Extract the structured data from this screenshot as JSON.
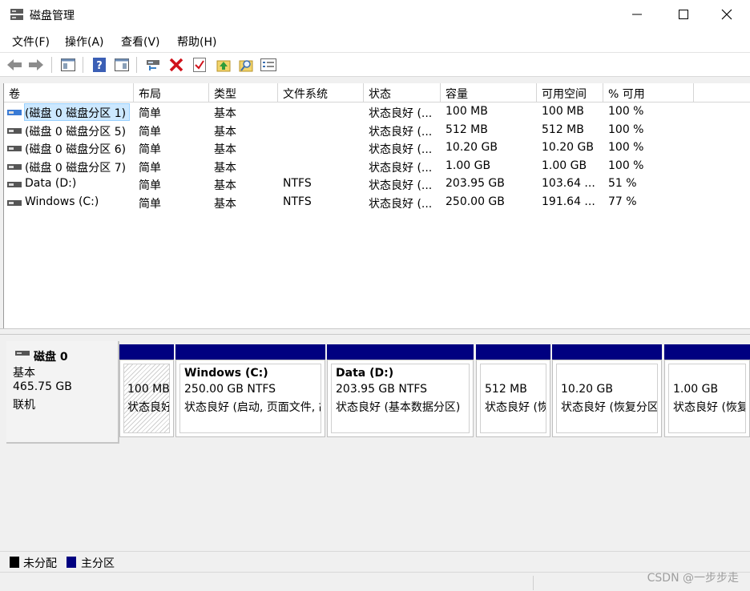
{
  "window": {
    "title": "磁盘管理",
    "icon": "disk-management-icon",
    "controls": [
      "minimize-icon",
      "maximize-icon",
      "close-icon"
    ]
  },
  "menu": [
    "文件(F)",
    "操作(A)",
    "查看(V)",
    "帮助(H)"
  ],
  "toolbar": [
    "back-icon",
    "forward-icon",
    "console-tree-icon",
    "help-icon",
    "show-pane-icon",
    "connect-disk-icon",
    "delete-icon",
    "properties-check-icon",
    "up-icon",
    "search-icon",
    "details-icon"
  ],
  "columns": [
    "卷",
    "布局",
    "类型",
    "文件系统",
    "状态",
    "容量",
    "可用空间",
    "% 可用"
  ],
  "volumes": [
    {
      "vol": "(磁盘 0 磁盘分区 1)",
      "layout": "简单",
      "type": "基本",
      "fs": "",
      "status": "状态良好 (...",
      "capacity": "100 MB",
      "free": "100 MB",
      "pct": "100 %",
      "selected": true
    },
    {
      "vol": "(磁盘 0 磁盘分区 5)",
      "layout": "简单",
      "type": "基本",
      "fs": "",
      "status": "状态良好 (...",
      "capacity": "512 MB",
      "free": "512 MB",
      "pct": "100 %"
    },
    {
      "vol": "(磁盘 0 磁盘分区 6)",
      "layout": "简单",
      "type": "基本",
      "fs": "",
      "status": "状态良好 (...",
      "capacity": "10.20 GB",
      "free": "10.20 GB",
      "pct": "100 %"
    },
    {
      "vol": "(磁盘 0 磁盘分区 7)",
      "layout": "简单",
      "type": "基本",
      "fs": "",
      "status": "状态良好 (...",
      "capacity": "1.00 GB",
      "free": "1.00 GB",
      "pct": "100 %"
    },
    {
      "vol": "Data (D:)",
      "layout": "简单",
      "type": "基本",
      "fs": "NTFS",
      "status": "状态良好 (...",
      "capacity": "203.95 GB",
      "free": "103.64 ...",
      "pct": "51 %"
    },
    {
      "vol": "Windows (C:)",
      "layout": "简单",
      "type": "基本",
      "fs": "NTFS",
      "status": "状态良好 (...",
      "capacity": "250.00 GB",
      "free": "191.64 ...",
      "pct": "77 %"
    }
  ],
  "disk": {
    "name": "磁盘 0",
    "type": "基本",
    "size": "465.75 GB",
    "state": "联机"
  },
  "partitions": [
    {
      "l1": "",
      "l2": "100 MB",
      "l3": "状态良好",
      "hatched": true
    },
    {
      "l1": "Windows  (C:)",
      "l2": "250.00 GB NTFS",
      "l3": "状态良好 (启动, 页面文件, 故障转储, 主分区)"
    },
    {
      "l1": "Data  (D:)",
      "l2": "203.95 GB NTFS",
      "l3": "状态良好 (基本数据分区)"
    },
    {
      "l1": "",
      "l2": "512 MB",
      "l3": "状态良好 (恢复分区)"
    },
    {
      "l1": "",
      "l2": "10.20 GB",
      "l3": "状态良好 (恢复分区)"
    },
    {
      "l1": "",
      "l2": "1.00 GB",
      "l3": "状态良好 (恢复分区)"
    }
  ],
  "legend": [
    {
      "label": "未分配",
      "color": "#000000"
    },
    {
      "label": "主分区",
      "color": "#000080"
    }
  ],
  "watermark": "CSDN @一步步走",
  "colors": {
    "primary_partition": "#000080",
    "selection": "#cce8ff"
  }
}
